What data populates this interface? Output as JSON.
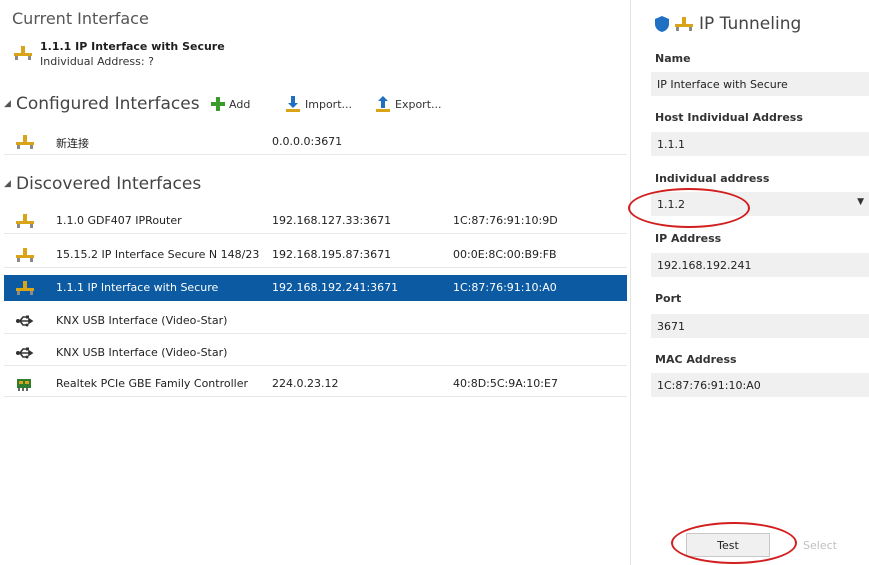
{
  "current": {
    "title": "Current Interface",
    "name": "1.1.1 IP Interface with Secure",
    "address": "Individual Address: ?"
  },
  "configured": {
    "title": "Configured Interfaces",
    "add_label": "Add",
    "import_label": "Import...",
    "export_label": "Export...",
    "rows": [
      {
        "name": "新连接",
        "address": "0.0.0.0:3671",
        "mac": ""
      }
    ]
  },
  "discovered": {
    "title": "Discovered Interfaces",
    "rows": [
      {
        "name": "1.1.0 GDF407 IPRouter",
        "address": "192.168.127.33:3671",
        "mac": "1C:87:76:91:10:9D",
        "icon": "network-icon"
      },
      {
        "name": "15.15.2 IP Interface Secure N 148/23",
        "address": "192.168.195.87:3671",
        "mac": "00:0E:8C:00:B9:FB",
        "icon": "network-icon"
      },
      {
        "name": "1.1.1 IP Interface with Secure",
        "address": "192.168.192.241:3671",
        "mac": "1C:87:76:91:10:A0",
        "icon": "network-icon",
        "selected": true
      },
      {
        "name": "KNX USB Interface (Video-Star)",
        "address": "",
        "mac": "",
        "icon": "usb-icon"
      },
      {
        "name": "KNX USB Interface (Video-Star)",
        "address": "",
        "mac": "",
        "icon": "usb-icon"
      },
      {
        "name": "Realtek PCIe GBE Family Controller",
        "address": "224.0.23.12",
        "mac": "40:8D:5C:9A:10:E7",
        "icon": "network-card-icon"
      }
    ]
  },
  "details": {
    "title": "IP Tunneling",
    "name_label": "Name",
    "name_value": "IP Interface with Secure",
    "host_label": "Host Individual Address",
    "host_value": "1.1.1",
    "indiv_label": "Individual address",
    "indiv_value": "1.1.2",
    "ip_label": "IP Address",
    "ip_value": "192.168.192.241",
    "port_label": "Port",
    "port_value": "3671",
    "mac_label": "MAC Address",
    "mac_value": "1C:87:76:91:10:A0",
    "test_label": "Test",
    "select_label": "Select"
  },
  "colors": {
    "selection": "#0b5aa2",
    "annotation": "#d21e1e",
    "add_green": "#3a9a2a",
    "shield_blue": "#1f6fc2",
    "network_yellow": "#d9a417"
  }
}
